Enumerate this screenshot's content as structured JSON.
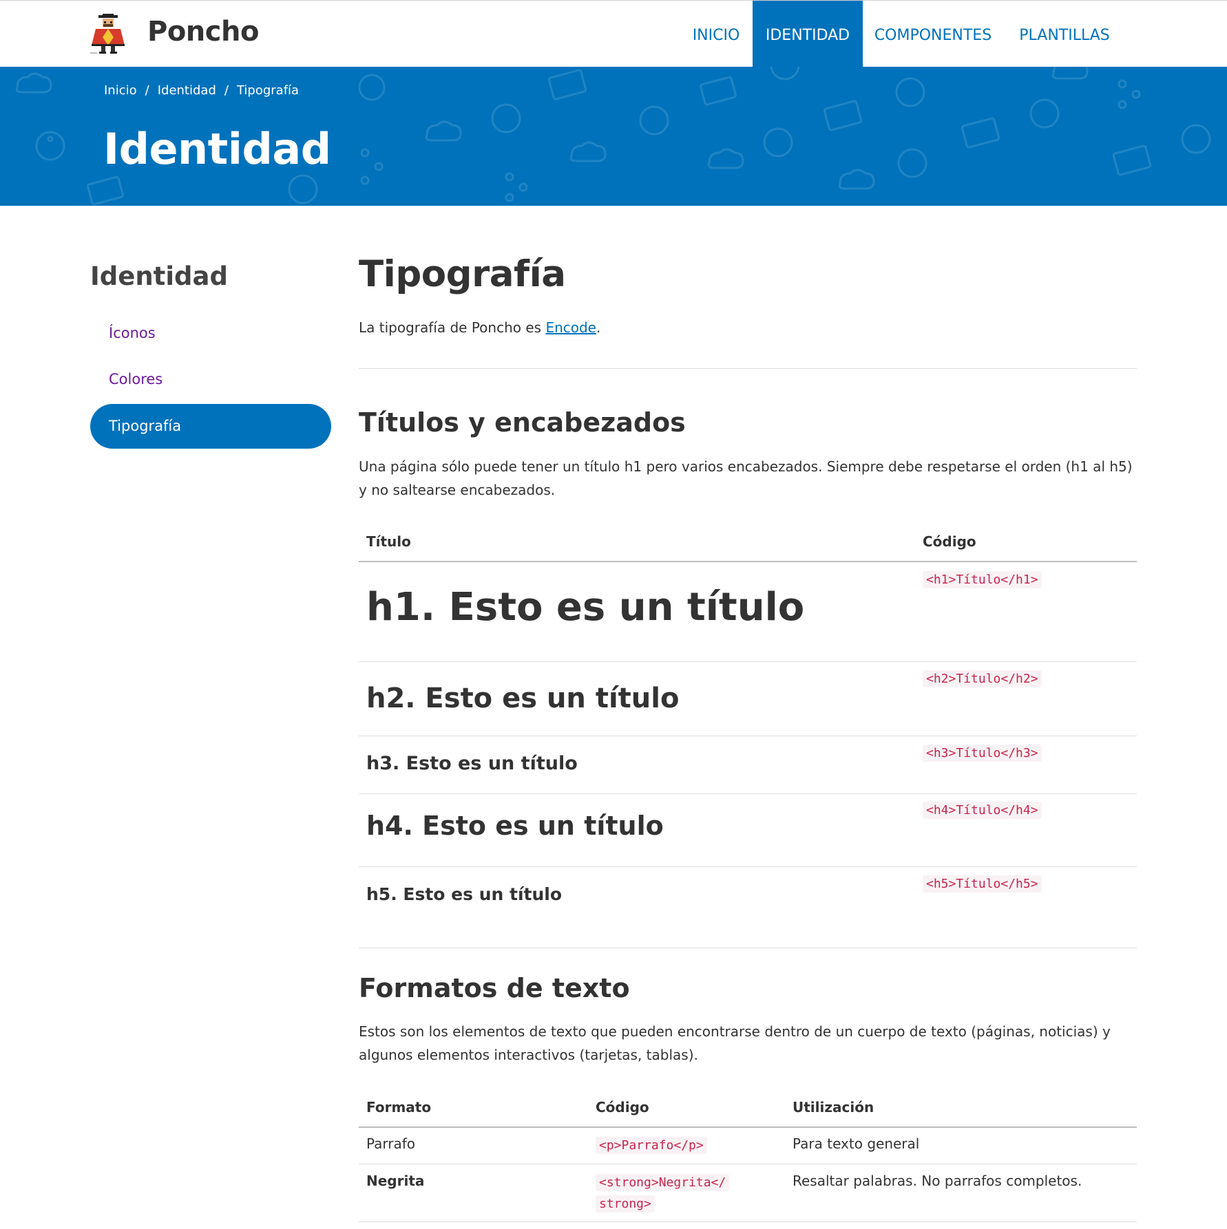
{
  "brand": {
    "name": "Poncho"
  },
  "nav": {
    "items": [
      {
        "label": "INICIO",
        "active": false
      },
      {
        "label": "IDENTIDAD",
        "active": true
      },
      {
        "label": "COMPONENTES",
        "active": false
      },
      {
        "label": "PLANTILLAS",
        "active": false
      }
    ]
  },
  "hero": {
    "breadcrumb": [
      "Inicio",
      "Identidad",
      "Tipografía"
    ],
    "breadcrumb_separator": "/",
    "title": "Identidad"
  },
  "sidebar": {
    "title": "Identidad",
    "items": [
      {
        "label": "Íconos",
        "active": false
      },
      {
        "label": "Colores",
        "active": false
      },
      {
        "label": "Tipografía",
        "active": true
      }
    ]
  },
  "main": {
    "title": "Tipografía",
    "intro_before": "La tipografía de Poncho es ",
    "intro_link": "Encode",
    "intro_after": ".",
    "headings_section": {
      "title": "Títulos y encabezados",
      "description": "Una página sólo puede tener un título h1 pero varios encabezados. Siempre debe respetarse el orden (h1 al h5) y no saltearse encabezados.",
      "columns": [
        "Título",
        "Código"
      ],
      "rows": [
        {
          "sample": "h1. Esto es un título",
          "code": "<h1>Título</h1>"
        },
        {
          "sample": "h2. Esto es un título",
          "code": "<h2>Título</h2>"
        },
        {
          "sample": "h3. Esto es un título",
          "code": "<h3>Título</h3>"
        },
        {
          "sample": "h4. Esto es un título",
          "code": "<h4>Título</h4>"
        },
        {
          "sample": "h5. Esto es un título",
          "code": "<h5>Título</h5>"
        }
      ]
    },
    "formats_section": {
      "title": "Formatos de texto",
      "description": "Estos son los elementos de texto que pueden encontrarse dentro de un cuerpo de texto (páginas, noticias) y algunos elementos interactivos (tarjetas, tablas).",
      "columns": [
        "Formato",
        "Código",
        "Utilización"
      ],
      "rows": [
        {
          "format": "Parrafo",
          "code": "<p>Parrafo</p>",
          "usage": "Para texto general"
        },
        {
          "format": "Negrita",
          "code_line1": "<strong>Negrita</",
          "code_line2": "strong>",
          "usage": "Resaltar palabras. No parrafos completos."
        }
      ]
    }
  },
  "colors": {
    "primary": "#0072bb",
    "visited_link": "#6a1b9a",
    "code_text": "#c7254e"
  }
}
